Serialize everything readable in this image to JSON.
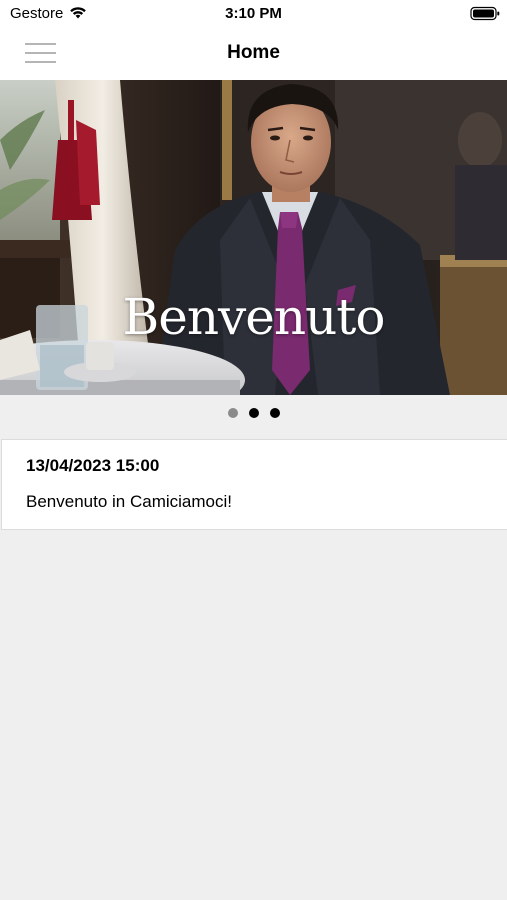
{
  "status_bar": {
    "carrier": "Gestore",
    "time": "3:10 PM"
  },
  "nav": {
    "title": "Home",
    "menu_icon": "hamburger-icon"
  },
  "hero": {
    "title": "Benvenuto"
  },
  "pager": {
    "count": 3,
    "active_index": 1
  },
  "news": [
    {
      "date": "13/04/2023 15:00",
      "text": "Benvenuto in Camiciamoci!"
    }
  ],
  "colors": {
    "background": "#efefef",
    "card": "#ffffff",
    "tie": "#7a2a6e",
    "suit": "#24262e",
    "tassel": "#9a1426"
  }
}
